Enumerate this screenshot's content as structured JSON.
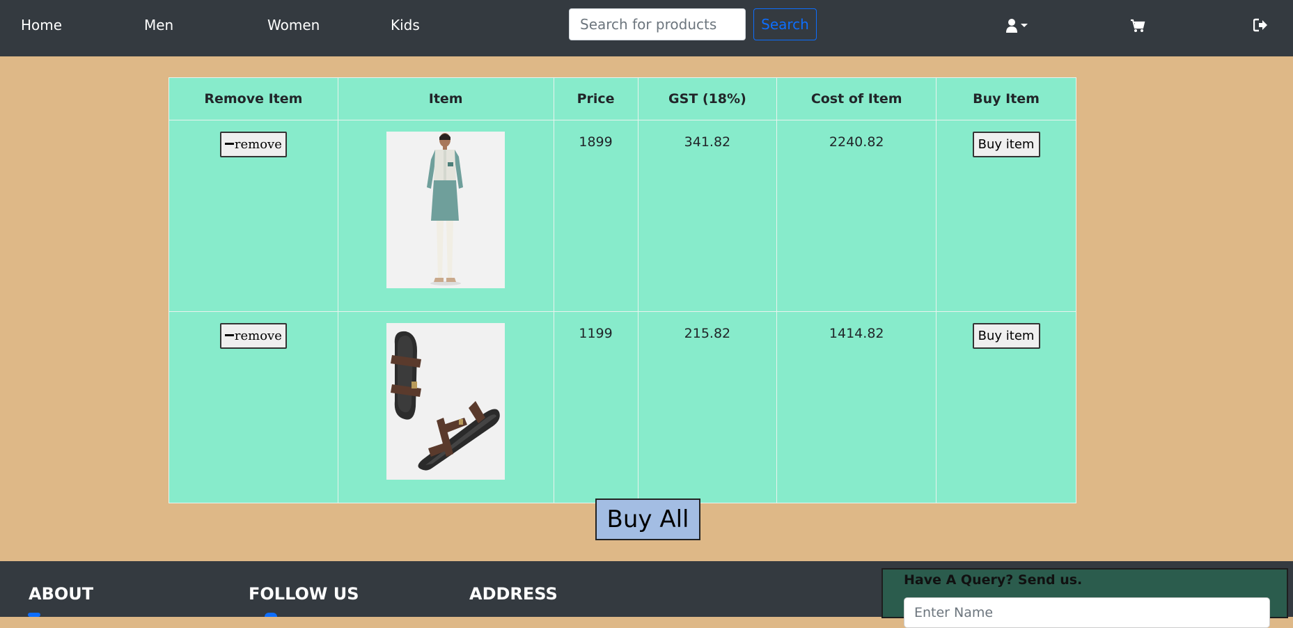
{
  "nav": {
    "links": [
      "Home",
      "Men",
      "Women",
      "Kids"
    ],
    "search_placeholder": "Search for products",
    "search_button": "Search",
    "icons": [
      "user-icon",
      "cart-icon",
      "logout-icon"
    ]
  },
  "cart": {
    "headers": [
      "Remove Item",
      "Item",
      "Price",
      "GST (18%)",
      "Cost of Item",
      "Buy Item"
    ],
    "rows": [
      {
        "remove_label": "remove",
        "item_image": "kurta-jacket-image",
        "price": "1899",
        "gst": "341.82",
        "cost": "2240.82",
        "buy_label": "Buy item"
      },
      {
        "remove_label": "remove",
        "item_image": "sandals-image",
        "price": "1199",
        "gst": "215.82",
        "cost": "1414.82",
        "buy_label": "Buy item"
      }
    ],
    "buy_all": "Buy All"
  },
  "footer": {
    "about": "ABOUT",
    "follow": "FOLLOW US",
    "address": "ADDRESS",
    "query_title": "Have A Query? Send us.",
    "name_placeholder": "Enter Name"
  },
  "colors": {
    "page_bg": "#deb887",
    "navbar_bg": "#343a40",
    "table_bg": "#87ebcb",
    "buy_all_bg": "#a3bde3",
    "query_bg": "#2b5c4d",
    "link_blue": "#0d6efd"
  }
}
